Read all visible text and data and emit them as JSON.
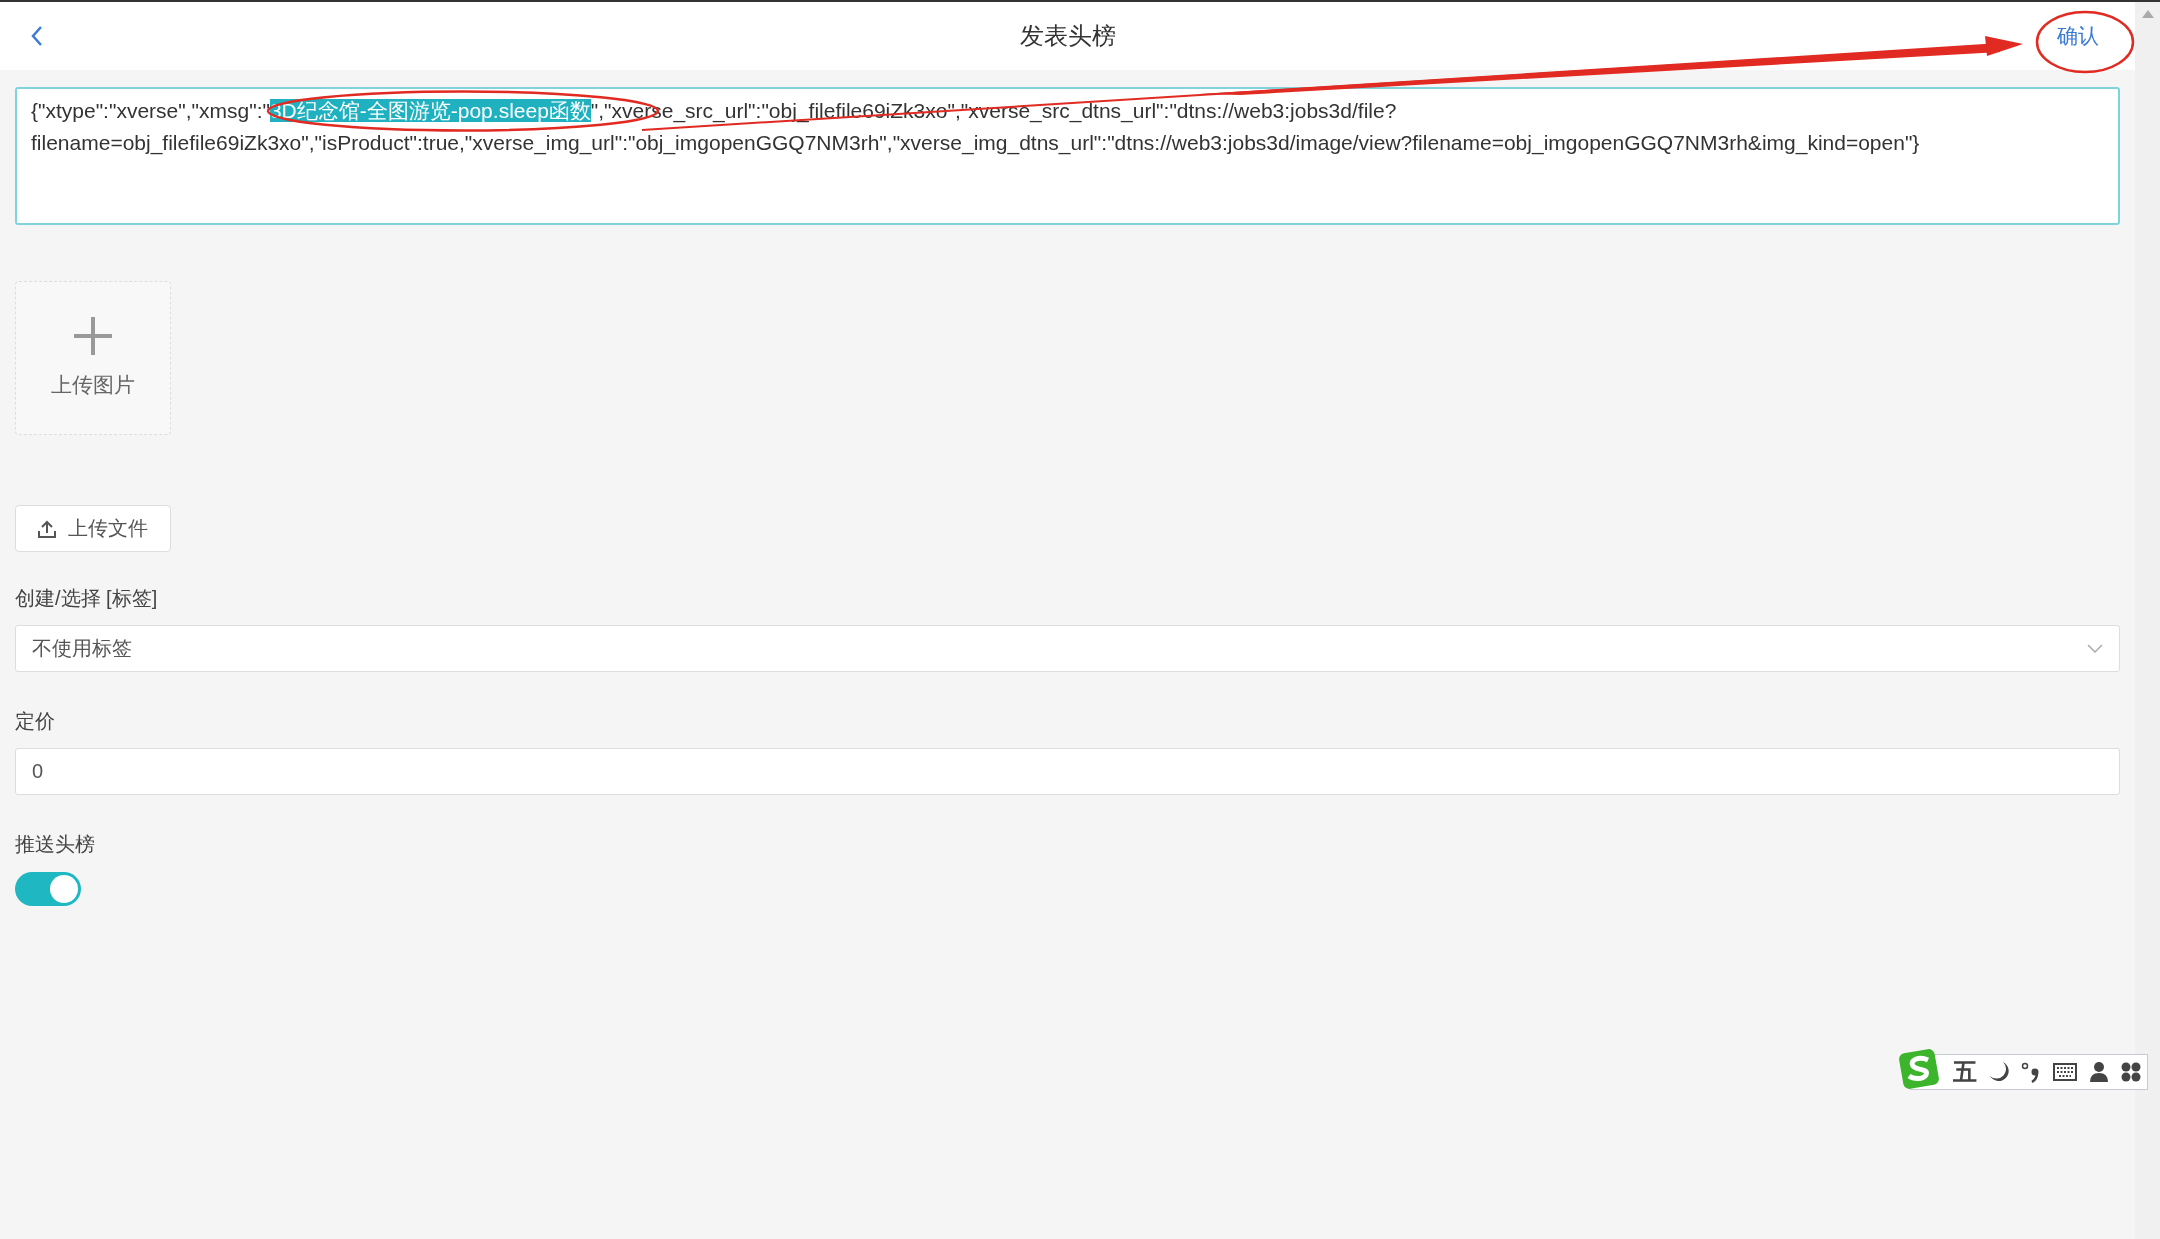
{
  "header": {
    "title": "发表头榜",
    "confirm": "确认"
  },
  "content_field": {
    "segments": [
      {
        "text": "{\"xtype\":\"xverse\",\"xmsg\":\"",
        "selected": false
      },
      {
        "text": "3D纪念馆-全图游览-pop.sleep函数",
        "selected": true
      },
      {
        "text": "\",\"xverse_src_url\":\"obj_filefile69iZk3xo\",\"xverse_src_dtns_url\":\"dtns://web3:jobs3d/file?filename=obj_filefile69iZk3xo\",\"isProduct\":true,\"xverse_img_url\":\"obj_imgopenGGQ7NM3rh\",\"xverse_img_dtns_url\":\"dtns://web3:jobs3d/image/view?filename=obj_imgopenGGQ7NM3rh&img_kind=open\"}",
        "selected": false
      }
    ]
  },
  "image_upload": {
    "label": "上传图片"
  },
  "file_upload": {
    "label": "上传文件"
  },
  "tag_select": {
    "label": "创建/选择 [标签]",
    "value": "不使用标签"
  },
  "price": {
    "label": "定价",
    "value": "0"
  },
  "push": {
    "label": "推送头榜",
    "on": true
  },
  "ime_toolbar": {
    "mode": "五"
  }
}
